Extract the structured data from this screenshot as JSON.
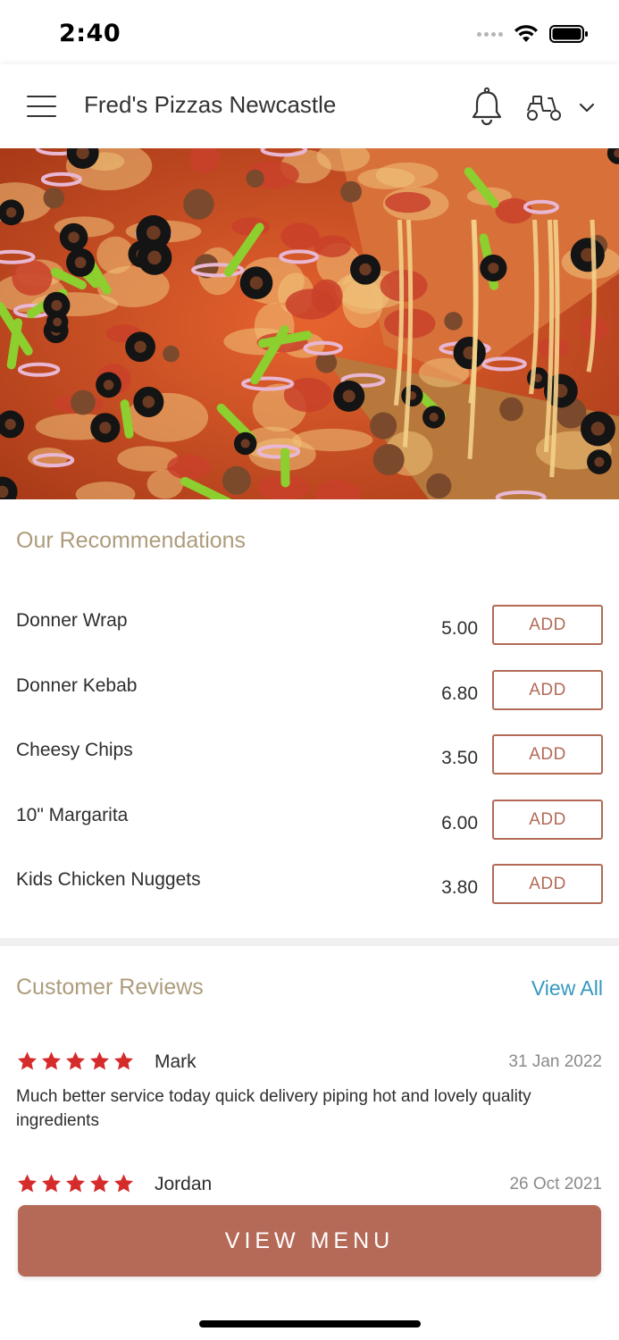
{
  "status_bar": {
    "time": "2:40",
    "wifi_icon": "wifi-icon",
    "battery_icon": "battery-icon"
  },
  "header": {
    "title": "Fred's Pizzas Newcastle",
    "menu_icon": "hamburger-menu-icon",
    "notification_icon": "bell-icon",
    "delivery_mode_icon": "scooter-icon",
    "dropdown_icon": "chevron-down-icon"
  },
  "hero": {
    "image": "pizza-hero-image"
  },
  "recommendations": {
    "title": "Our Recommendations",
    "items": [
      {
        "name": "Donner Wrap",
        "price": "5.00",
        "action": "ADD"
      },
      {
        "name": "Donner Kebab",
        "price": "6.80",
        "action": "ADD"
      },
      {
        "name": "Cheesy Chips",
        "price": "3.50",
        "action": "ADD"
      },
      {
        "name": "10\" Margarita",
        "price": "6.00",
        "action": "ADD"
      },
      {
        "name": "Kids Chicken Nuggets",
        "price": "3.80",
        "action": "ADD"
      }
    ]
  },
  "reviews": {
    "title": "Customer Reviews",
    "view_all": "View All",
    "items": [
      {
        "rating": 5,
        "name": "Mark",
        "date": "31 Jan 2022",
        "text": "Much better service today quick delivery piping hot and lovely quality ingredients"
      },
      {
        "rating": 5,
        "name": "Jordan",
        "date": "26 Oct 2021",
        "text": ""
      }
    ]
  },
  "cta": {
    "label": "VIEW MENU"
  },
  "colors": {
    "accent": "#b56a57",
    "section_title": "#ad9c7c",
    "link": "#3598be",
    "star": "#d62b2b"
  }
}
